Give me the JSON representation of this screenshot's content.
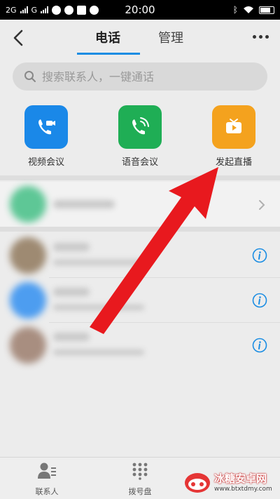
{
  "status_bar": {
    "left_text": "2G",
    "carrier_mark": "G",
    "time": "20:00"
  },
  "header": {
    "tabs": [
      {
        "label": "电话",
        "active": true
      },
      {
        "label": "管理",
        "active": false
      }
    ]
  },
  "search": {
    "placeholder": "搜索联系人，一键通话"
  },
  "quick_actions": [
    {
      "label": "视频会议",
      "icon": "video-call-icon",
      "color": "#1a88e8"
    },
    {
      "label": "语音会议",
      "icon": "phone-call-icon",
      "color": "#1fae55"
    },
    {
      "label": "发起直播",
      "icon": "tv-live-icon",
      "color": "#f4a21e"
    }
  ],
  "bottom_nav": [
    {
      "label": "联系人",
      "icon": "contacts-icon"
    },
    {
      "label": "拨号盘",
      "icon": "dialpad-icon"
    }
  ],
  "watermark": {
    "name": "冰糖安卓网",
    "url": "www.btxtdmy.com"
  },
  "colors": {
    "accent": "#1a8de3",
    "arrow": "#e8191e"
  }
}
